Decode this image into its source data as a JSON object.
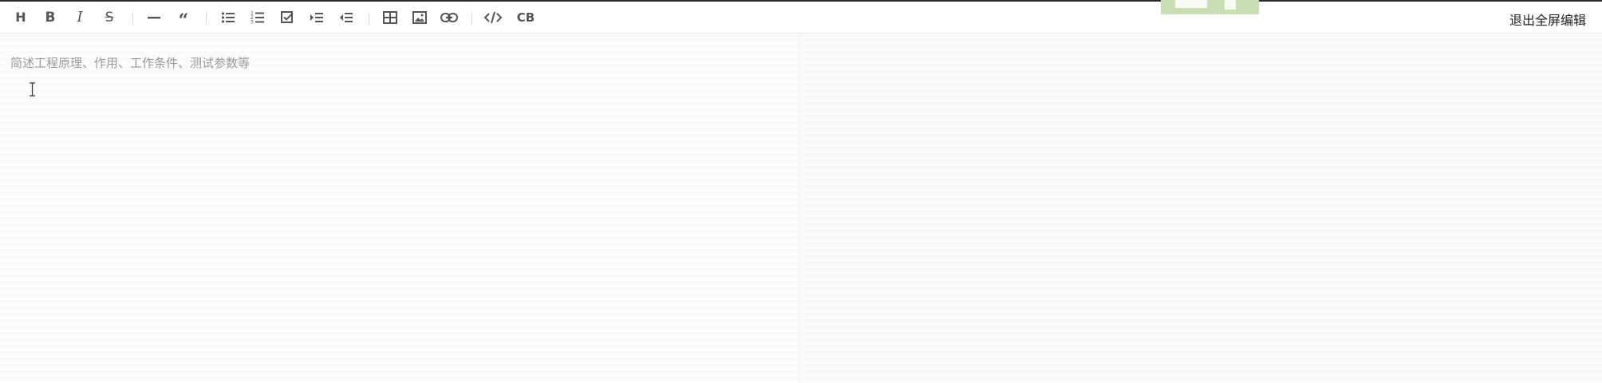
{
  "toolbar": {
    "heading_label": "H",
    "bold_label": "B",
    "italic_label": "I",
    "strike_label": "S",
    "quote_label": "“",
    "codeblock_label": "CB",
    "exit_fullscreen_label": "退出全屏编辑"
  },
  "editor": {
    "placeholder": "简述工程原理、作用、工作条件、测试参数等",
    "value": ""
  },
  "colors": {
    "icon": "#555555",
    "separator": "#d6d6d6",
    "placeholder": "#999999",
    "logo_fragment": "#c9dfb3"
  },
  "icons": [
    "heading-icon",
    "bold-icon",
    "italic-icon",
    "strikethrough-icon",
    "horizontal-rule-icon",
    "quote-icon",
    "unordered-list-icon",
    "ordered-list-icon",
    "checklist-icon",
    "indent-icon",
    "outdent-icon",
    "table-icon",
    "image-icon",
    "link-icon",
    "code-icon",
    "codeblock-icon",
    "text-cursor-icon"
  ]
}
